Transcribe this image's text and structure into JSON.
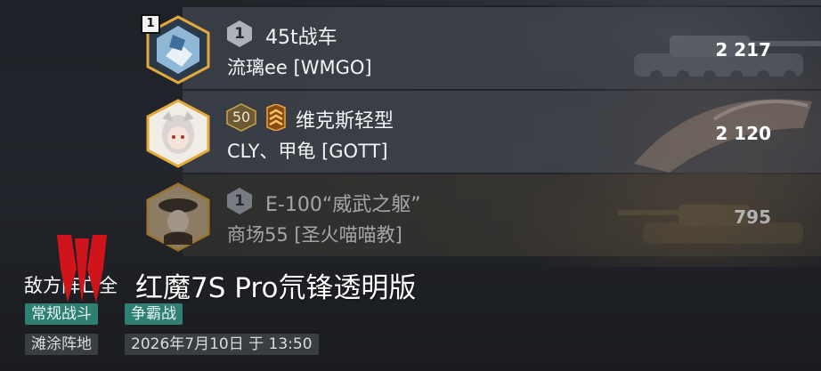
{
  "players": [
    {
      "rank_flag": "1",
      "tier_badge": "1",
      "level_badge": "",
      "tank_name": "45t战车",
      "player_name": "流璃ee [WMGO]",
      "score": "2 217"
    },
    {
      "rank_flag": "",
      "tier_badge": "",
      "level_badge": "50",
      "tank_name": "维克斯轻型",
      "player_name": "CLY、甲龟 [GOTT]",
      "score": "2 120"
    },
    {
      "rank_flag": "",
      "tier_badge": "1",
      "level_badge": "",
      "tank_name": "E-100“威武之躯”",
      "player_name": "商场55 [圣火喵喵教]",
      "score": "795"
    }
  ],
  "footer": {
    "caption": "敌方阵亡全",
    "watermark": "红魔7S Pro氘锋透明版",
    "mode_tags": [
      "常规战斗",
      "争霸战"
    ],
    "map_name": "滩涂阵地",
    "datetime": "2026年7月10日 于 13:50"
  },
  "colors": {
    "hex_border": "#e3a93a",
    "mode_tag": "#2f7f73",
    "logo_red": "#d0141c"
  }
}
